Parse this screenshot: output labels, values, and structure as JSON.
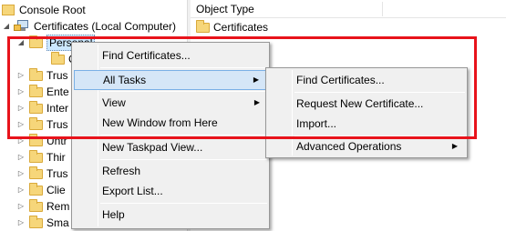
{
  "tree": {
    "console_root": "Console Root",
    "certificates_local": "Certificates (Local Computer)",
    "personal": "Personal",
    "child_c": "C",
    "nodes": [
      "Trus",
      "Ente",
      "Inter",
      "Trus",
      "Untr",
      "Thir",
      "Trus",
      "Clie",
      "Rem",
      "Sma"
    ]
  },
  "list": {
    "column_header": "Object Type",
    "rows": [
      "Certificates"
    ]
  },
  "context_menu": {
    "items": {
      "find": "Find Certificates...",
      "all_tasks": "All Tasks",
      "view": "View",
      "new_window": "New Window from Here",
      "new_taskpad": "New Taskpad View...",
      "refresh": "Refresh",
      "export": "Export List...",
      "help": "Help"
    }
  },
  "submenu": {
    "items": {
      "find": "Find Certificates...",
      "request": "Request New Certificate...",
      "import": "Import...",
      "advanced": "Advanced Operations"
    }
  },
  "colors": {
    "highlight_box": "#e8131b",
    "menu_bg": "#f0f0f0",
    "hover_bg": "#d5e6f7",
    "folder": "#f6d67a"
  }
}
